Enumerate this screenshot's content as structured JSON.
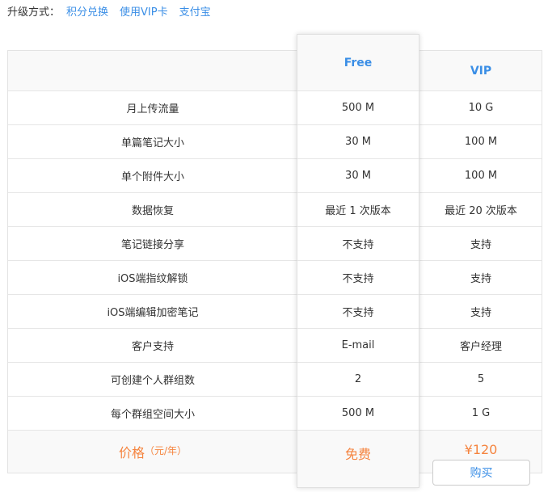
{
  "upgrade": {
    "label": "升级方式：",
    "methods": [
      "积分兑换",
      "使用VIP卡",
      "支付宝"
    ]
  },
  "columns": {
    "free": "Free",
    "vip": "VIP"
  },
  "rows": [
    {
      "feature": "月上传流量",
      "free": "500 M",
      "vip": "10 G"
    },
    {
      "feature": "单篇笔记大小",
      "free": "30 M",
      "vip": "100 M"
    },
    {
      "feature": "单个附件大小",
      "free": "30 M",
      "vip": "100 M"
    },
    {
      "feature": "数据恢复",
      "free": "最近 1 次版本",
      "vip": "最近 20 次版本"
    },
    {
      "feature": "笔记链接分享",
      "free": "不支持",
      "vip": "支持"
    },
    {
      "feature": "iOS端指纹解锁",
      "free": "不支持",
      "vip": "支持"
    },
    {
      "feature": "iOS端编辑加密笔记",
      "free": "不支持",
      "vip": "支持"
    },
    {
      "feature": "客户支持",
      "free": "E-mail",
      "vip": "客户经理"
    },
    {
      "feature": "可创建个人群组数",
      "free": "2",
      "vip": "5"
    },
    {
      "feature": "每个群组空间大小",
      "free": "500 M",
      "vip": "1 G"
    }
  ],
  "price": {
    "label": "价格",
    "unit": "（元/年）",
    "free": "免费",
    "vip": "¥120",
    "buy": "购买"
  }
}
